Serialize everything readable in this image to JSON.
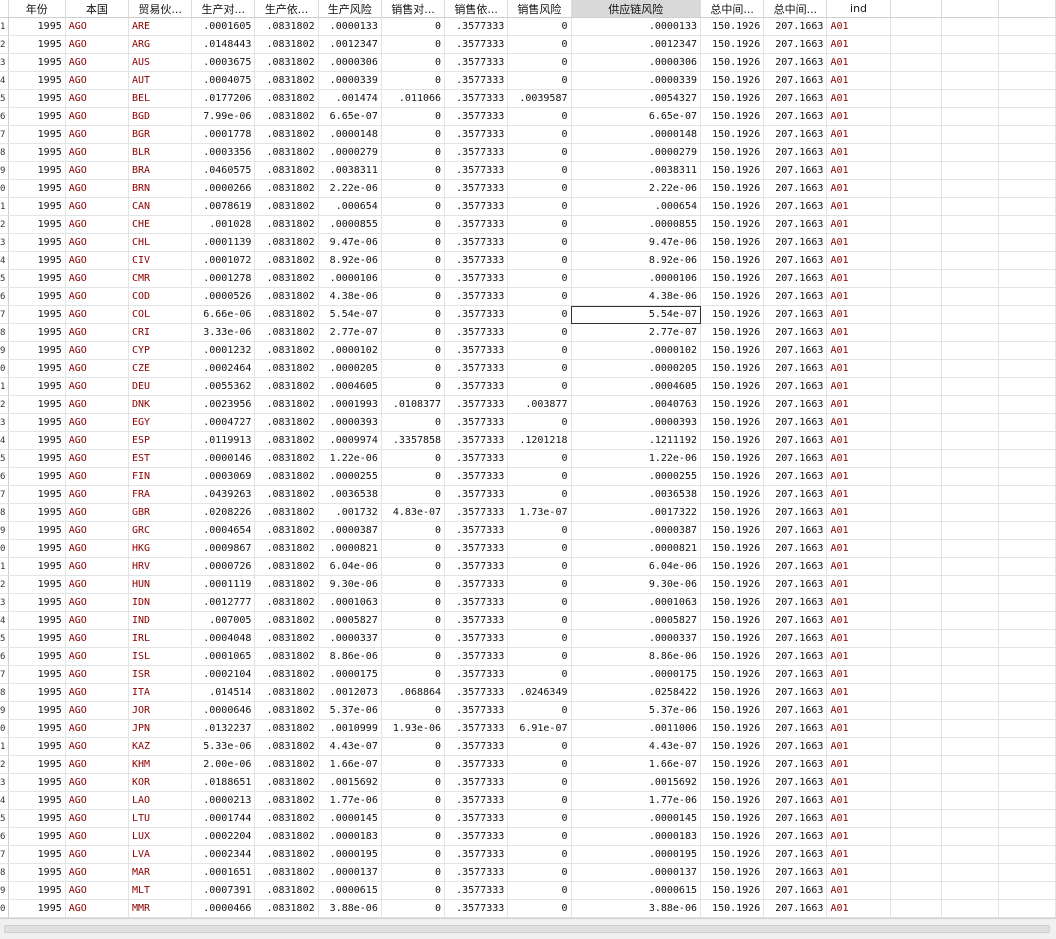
{
  "grid": {
    "columns": [
      "年份",
      "本国",
      "贸易伙...",
      "生产对...",
      "生产依...",
      "生产风险",
      "销售对...",
      "销售依...",
      "销售风险",
      "供应链风险",
      "总中间...",
      "总中间...",
      "ind"
    ],
    "types": [
      "num",
      "str",
      "str",
      "num",
      "num",
      "num",
      "num",
      "num",
      "num",
      "num",
      "num",
      "num",
      "str"
    ],
    "row_labels": [
      "1",
      "2",
      "3",
      "4",
      "5",
      "6",
      "7",
      "8",
      "9",
      "0",
      "1",
      "2",
      "3",
      "4",
      "5",
      "6",
      "7",
      "8",
      "9",
      "0",
      "1",
      "2",
      "3",
      "4",
      "5",
      "6",
      "7",
      "8",
      "9",
      "0",
      "1",
      "2",
      "3",
      "4",
      "5",
      "6",
      "7",
      "8",
      "9",
      "0",
      "1",
      "2",
      "3",
      "4",
      "5",
      "6",
      "7",
      "8",
      "9",
      "0"
    ],
    "rows": [
      [
        "1995",
        "AGO",
        "ARE",
        ".0001605",
        ".0831802",
        ".0000133",
        "0",
        ".3577333",
        "0",
        ".0000133",
        "150.1926",
        "207.1663",
        "A01"
      ],
      [
        "1995",
        "AGO",
        "ARG",
        ".0148443",
        ".0831802",
        ".0012347",
        "0",
        ".3577333",
        "0",
        ".0012347",
        "150.1926",
        "207.1663",
        "A01"
      ],
      [
        "1995",
        "AGO",
        "AUS",
        ".0003675",
        ".0831802",
        ".0000306",
        "0",
        ".3577333",
        "0",
        ".0000306",
        "150.1926",
        "207.1663",
        "A01"
      ],
      [
        "1995",
        "AGO",
        "AUT",
        ".0004075",
        ".0831802",
        ".0000339",
        "0",
        ".3577333",
        "0",
        ".0000339",
        "150.1926",
        "207.1663",
        "A01"
      ],
      [
        "1995",
        "AGO",
        "BEL",
        ".0177206",
        ".0831802",
        ".001474",
        ".011066",
        ".3577333",
        ".0039587",
        ".0054327",
        "150.1926",
        "207.1663",
        "A01"
      ],
      [
        "1995",
        "AGO",
        "BGD",
        "7.99e-06",
        ".0831802",
        "6.65e-07",
        "0",
        ".3577333",
        "0",
        "6.65e-07",
        "150.1926",
        "207.1663",
        "A01"
      ],
      [
        "1995",
        "AGO",
        "BGR",
        ".0001778",
        ".0831802",
        ".0000148",
        "0",
        ".3577333",
        "0",
        ".0000148",
        "150.1926",
        "207.1663",
        "A01"
      ],
      [
        "1995",
        "AGO",
        "BLR",
        ".0003356",
        ".0831802",
        ".0000279",
        "0",
        ".3577333",
        "0",
        ".0000279",
        "150.1926",
        "207.1663",
        "A01"
      ],
      [
        "1995",
        "AGO",
        "BRA",
        ".0460575",
        ".0831802",
        ".0038311",
        "0",
        ".3577333",
        "0",
        ".0038311",
        "150.1926",
        "207.1663",
        "A01"
      ],
      [
        "1995",
        "AGO",
        "BRN",
        ".0000266",
        ".0831802",
        "2.22e-06",
        "0",
        ".3577333",
        "0",
        "2.22e-06",
        "150.1926",
        "207.1663",
        "A01"
      ],
      [
        "1995",
        "AGO",
        "CAN",
        ".0078619",
        ".0831802",
        ".000654",
        "0",
        ".3577333",
        "0",
        ".000654",
        "150.1926",
        "207.1663",
        "A01"
      ],
      [
        "1995",
        "AGO",
        "CHE",
        ".001028",
        ".0831802",
        ".0000855",
        "0",
        ".3577333",
        "0",
        ".0000855",
        "150.1926",
        "207.1663",
        "A01"
      ],
      [
        "1995",
        "AGO",
        "CHL",
        ".0001139",
        ".0831802",
        "9.47e-06",
        "0",
        ".3577333",
        "0",
        "9.47e-06",
        "150.1926",
        "207.1663",
        "A01"
      ],
      [
        "1995",
        "AGO",
        "CIV",
        ".0001072",
        ".0831802",
        "8.92e-06",
        "0",
        ".3577333",
        "0",
        "8.92e-06",
        "150.1926",
        "207.1663",
        "A01"
      ],
      [
        "1995",
        "AGO",
        "CMR",
        ".0001278",
        ".0831802",
        ".0000106",
        "0",
        ".3577333",
        "0",
        ".0000106",
        "150.1926",
        "207.1663",
        "A01"
      ],
      [
        "1995",
        "AGO",
        "COD",
        ".0000526",
        ".0831802",
        "4.38e-06",
        "0",
        ".3577333",
        "0",
        "4.38e-06",
        "150.1926",
        "207.1663",
        "A01"
      ],
      [
        "1995",
        "AGO",
        "COL",
        "6.66e-06",
        ".0831802",
        "5.54e-07",
        "0",
        ".3577333",
        "0",
        "5.54e-07",
        "150.1926",
        "207.1663",
        "A01"
      ],
      [
        "1995",
        "AGO",
        "CRI",
        "3.33e-06",
        ".0831802",
        "2.77e-07",
        "0",
        ".3577333",
        "0",
        "2.77e-07",
        "150.1926",
        "207.1663",
        "A01"
      ],
      [
        "1995",
        "AGO",
        "CYP",
        ".0001232",
        ".0831802",
        ".0000102",
        "0",
        ".3577333",
        "0",
        ".0000102",
        "150.1926",
        "207.1663",
        "A01"
      ],
      [
        "1995",
        "AGO",
        "CZE",
        ".0002464",
        ".0831802",
        ".0000205",
        "0",
        ".3577333",
        "0",
        ".0000205",
        "150.1926",
        "207.1663",
        "A01"
      ],
      [
        "1995",
        "AGO",
        "DEU",
        ".0055362",
        ".0831802",
        ".0004605",
        "0",
        ".3577333",
        "0",
        ".0004605",
        "150.1926",
        "207.1663",
        "A01"
      ],
      [
        "1995",
        "AGO",
        "DNK",
        ".0023956",
        ".0831802",
        ".0001993",
        ".0108377",
        ".3577333",
        ".003877",
        ".0040763",
        "150.1926",
        "207.1663",
        "A01"
      ],
      [
        "1995",
        "AGO",
        "EGY",
        ".0004727",
        ".0831802",
        ".0000393",
        "0",
        ".3577333",
        "0",
        ".0000393",
        "150.1926",
        "207.1663",
        "A01"
      ],
      [
        "1995",
        "AGO",
        "ESP",
        ".0119913",
        ".0831802",
        ".0009974",
        ".3357858",
        ".3577333",
        ".1201218",
        ".1211192",
        "150.1926",
        "207.1663",
        "A01"
      ],
      [
        "1995",
        "AGO",
        "EST",
        ".0000146",
        ".0831802",
        "1.22e-06",
        "0",
        ".3577333",
        "0",
        "1.22e-06",
        "150.1926",
        "207.1663",
        "A01"
      ],
      [
        "1995",
        "AGO",
        "FIN",
        ".0003069",
        ".0831802",
        ".0000255",
        "0",
        ".3577333",
        "0",
        ".0000255",
        "150.1926",
        "207.1663",
        "A01"
      ],
      [
        "1995",
        "AGO",
        "FRA",
        ".0439263",
        ".0831802",
        ".0036538",
        "0",
        ".3577333",
        "0",
        ".0036538",
        "150.1926",
        "207.1663",
        "A01"
      ],
      [
        "1995",
        "AGO",
        "GBR",
        ".0208226",
        ".0831802",
        ".001732",
        "4.83e-07",
        ".3577333",
        "1.73e-07",
        ".0017322",
        "150.1926",
        "207.1663",
        "A01"
      ],
      [
        "1995",
        "AGO",
        "GRC",
        ".0004654",
        ".0831802",
        ".0000387",
        "0",
        ".3577333",
        "0",
        ".0000387",
        "150.1926",
        "207.1663",
        "A01"
      ],
      [
        "1995",
        "AGO",
        "HKG",
        ".0009867",
        ".0831802",
        ".0000821",
        "0",
        ".3577333",
        "0",
        ".0000821",
        "150.1926",
        "207.1663",
        "A01"
      ],
      [
        "1995",
        "AGO",
        "HRV",
        ".0000726",
        ".0831802",
        "6.04e-06",
        "0",
        ".3577333",
        "0",
        "6.04e-06",
        "150.1926",
        "207.1663",
        "A01"
      ],
      [
        "1995",
        "AGO",
        "HUN",
        ".0001119",
        ".0831802",
        "9.30e-06",
        "0",
        ".3577333",
        "0",
        "9.30e-06",
        "150.1926",
        "207.1663",
        "A01"
      ],
      [
        "1995",
        "AGO",
        "IDN",
        ".0012777",
        ".0831802",
        ".0001063",
        "0",
        ".3577333",
        "0",
        ".0001063",
        "150.1926",
        "207.1663",
        "A01"
      ],
      [
        "1995",
        "AGO",
        "IND",
        ".007005",
        ".0831802",
        ".0005827",
        "0",
        ".3577333",
        "0",
        ".0005827",
        "150.1926",
        "207.1663",
        "A01"
      ],
      [
        "1995",
        "AGO",
        "IRL",
        ".0004048",
        ".0831802",
        ".0000337",
        "0",
        ".3577333",
        "0",
        ".0000337",
        "150.1926",
        "207.1663",
        "A01"
      ],
      [
        "1995",
        "AGO",
        "ISL",
        ".0001065",
        ".0831802",
        "8.86e-06",
        "0",
        ".3577333",
        "0",
        "8.86e-06",
        "150.1926",
        "207.1663",
        "A01"
      ],
      [
        "1995",
        "AGO",
        "ISR",
        ".0002104",
        ".0831802",
        ".0000175",
        "0",
        ".3577333",
        "0",
        ".0000175",
        "150.1926",
        "207.1663",
        "A01"
      ],
      [
        "1995",
        "AGO",
        "ITA",
        ".014514",
        ".0831802",
        ".0012073",
        ".068864",
        ".3577333",
        ".0246349",
        ".0258422",
        "150.1926",
        "207.1663",
        "A01"
      ],
      [
        "1995",
        "AGO",
        "JOR",
        ".0000646",
        ".0831802",
        "5.37e-06",
        "0",
        ".3577333",
        "0",
        "5.37e-06",
        "150.1926",
        "207.1663",
        "A01"
      ],
      [
        "1995",
        "AGO",
        "JPN",
        ".0132237",
        ".0831802",
        ".0010999",
        "1.93e-06",
        ".3577333",
        "6.91e-07",
        ".0011006",
        "150.1926",
        "207.1663",
        "A01"
      ],
      [
        "1995",
        "AGO",
        "KAZ",
        "5.33e-06",
        ".0831802",
        "4.43e-07",
        "0",
        ".3577333",
        "0",
        "4.43e-07",
        "150.1926",
        "207.1663",
        "A01"
      ],
      [
        "1995",
        "AGO",
        "KHM",
        "2.00e-06",
        ".0831802",
        "1.66e-07",
        "0",
        ".3577333",
        "0",
        "1.66e-07",
        "150.1926",
        "207.1663",
        "A01"
      ],
      [
        "1995",
        "AGO",
        "KOR",
        ".0188651",
        ".0831802",
        ".0015692",
        "0",
        ".3577333",
        "0",
        ".0015692",
        "150.1926",
        "207.1663",
        "A01"
      ],
      [
        "1995",
        "AGO",
        "LAO",
        ".0000213",
        ".0831802",
        "1.77e-06",
        "0",
        ".3577333",
        "0",
        "1.77e-06",
        "150.1926",
        "207.1663",
        "A01"
      ],
      [
        "1995",
        "AGO",
        "LTU",
        ".0001744",
        ".0831802",
        ".0000145",
        "0",
        ".3577333",
        "0",
        ".0000145",
        "150.1926",
        "207.1663",
        "A01"
      ],
      [
        "1995",
        "AGO",
        "LUX",
        ".0002204",
        ".0831802",
        ".0000183",
        "0",
        ".3577333",
        "0",
        ".0000183",
        "150.1926",
        "207.1663",
        "A01"
      ],
      [
        "1995",
        "AGO",
        "LVA",
        ".0002344",
        ".0831802",
        ".0000195",
        "0",
        ".3577333",
        "0",
        ".0000195",
        "150.1926",
        "207.1663",
        "A01"
      ],
      [
        "1995",
        "AGO",
        "MAR",
        ".0001651",
        ".0831802",
        ".0000137",
        "0",
        ".3577333",
        "0",
        ".0000137",
        "150.1926",
        "207.1663",
        "A01"
      ],
      [
        "1995",
        "AGO",
        "MLT",
        ".0007391",
        ".0831802",
        ".0000615",
        "0",
        ".3577333",
        "0",
        ".0000615",
        "150.1926",
        "207.1663",
        "A01"
      ],
      [
        "1995",
        "AGO",
        "MMR",
        ".0000466",
        ".0831802",
        "3.88e-06",
        "0",
        ".3577333",
        "0",
        "3.88e-06",
        "150.1926",
        "207.1663",
        "A01"
      ]
    ],
    "selected_column": 9,
    "selected_row": 16,
    "colors": {
      "string_text": "#8b0000",
      "header_selected_bg": "#d9d9d9",
      "grid_line": "#e4e4e4"
    }
  }
}
